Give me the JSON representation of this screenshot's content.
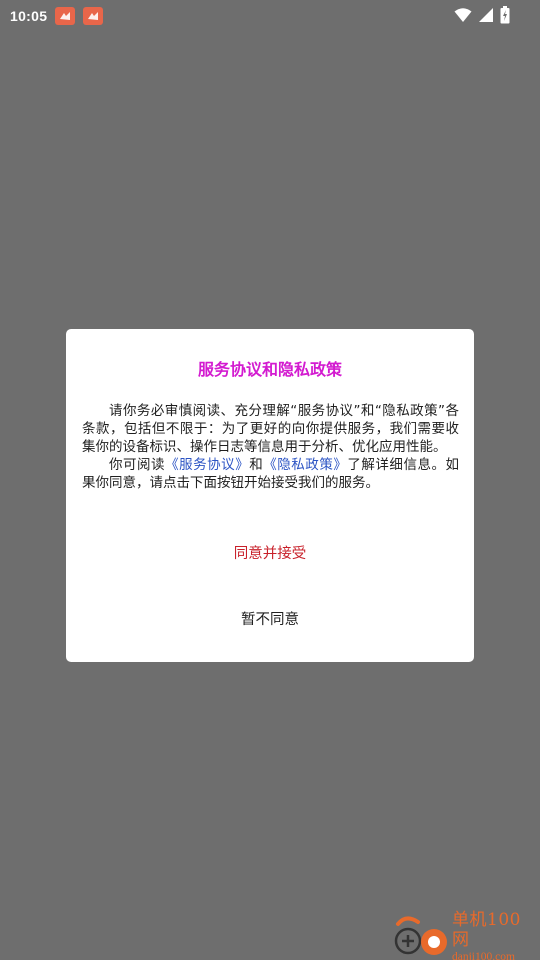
{
  "status_bar": {
    "time": "10:05",
    "notification_icons": [
      "app-notification-icon",
      "app-notification-icon"
    ],
    "right_icons": [
      "wifi-icon",
      "signal-icon",
      "battery-icon"
    ]
  },
  "dialog": {
    "title": "服务协议和隐私政策",
    "paragraph1": "请你务必审慎阅读、充分理解“服务协议”和“隐私政策”各条款，包括但不限于：为了更好的向你提供服务，我们需要收集你的设备标识、操作日志等信息用于分析、优化应用性能。",
    "paragraph2_prefix": "你可阅读",
    "service_link": "《服务协议》",
    "paragraph2_and": "和",
    "privacy_link": "《隐私政策》",
    "paragraph2_suffix": "了解详细信息。如果你同意，请点击下面按钮开始接受我们的服务。",
    "agree_label": "同意并接受",
    "disagree_label": "暂不同意",
    "colors": {
      "title": "#d31bd0",
      "link": "#2c54c4",
      "agree": "#c8202a"
    }
  },
  "watermark": {
    "name": "单机100网",
    "domain": "danji100.com",
    "color": "#e86a2b"
  }
}
